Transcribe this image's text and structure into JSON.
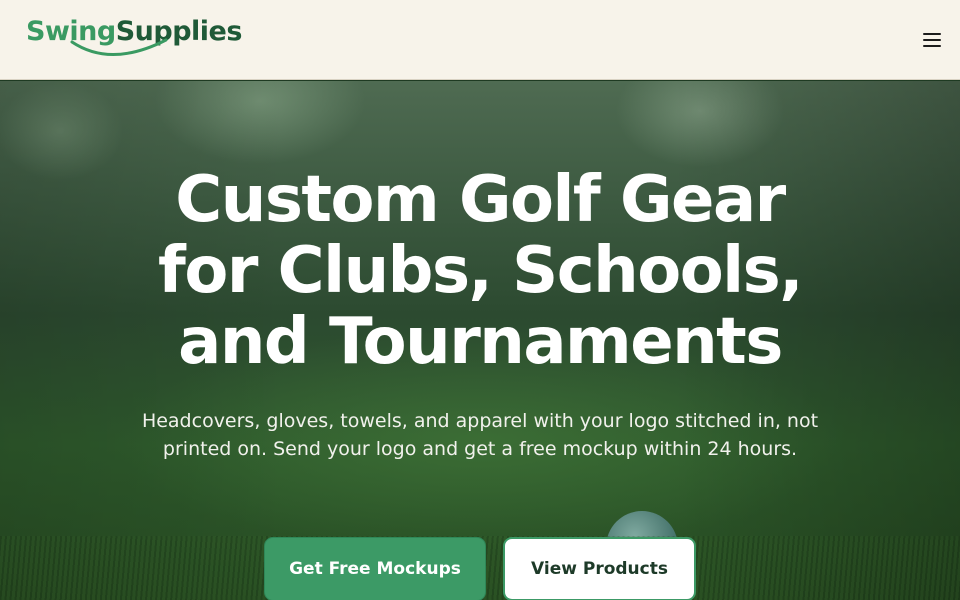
{
  "header": {
    "logo": {
      "part1": "Swing",
      "part2": "Supplies"
    },
    "menu_icon": "hamburger-menu-icon"
  },
  "hero": {
    "title_lines": [
      "Custom Golf Gear",
      "for Clubs, Schools,",
      "and Tournaments"
    ],
    "subtitle_lines": [
      "Headcovers, gloves, towels, and apparel with your logo stitched in, not",
      "printed on. Send your logo and get a free mockup within 24 hours."
    ],
    "primary_cta": "Get Free Mockups",
    "secondary_cta": "View Products"
  },
  "colors": {
    "brand_green": "#3c9a66",
    "brand_dark": "#1f5a38",
    "header_bg": "#f7f3ea"
  }
}
